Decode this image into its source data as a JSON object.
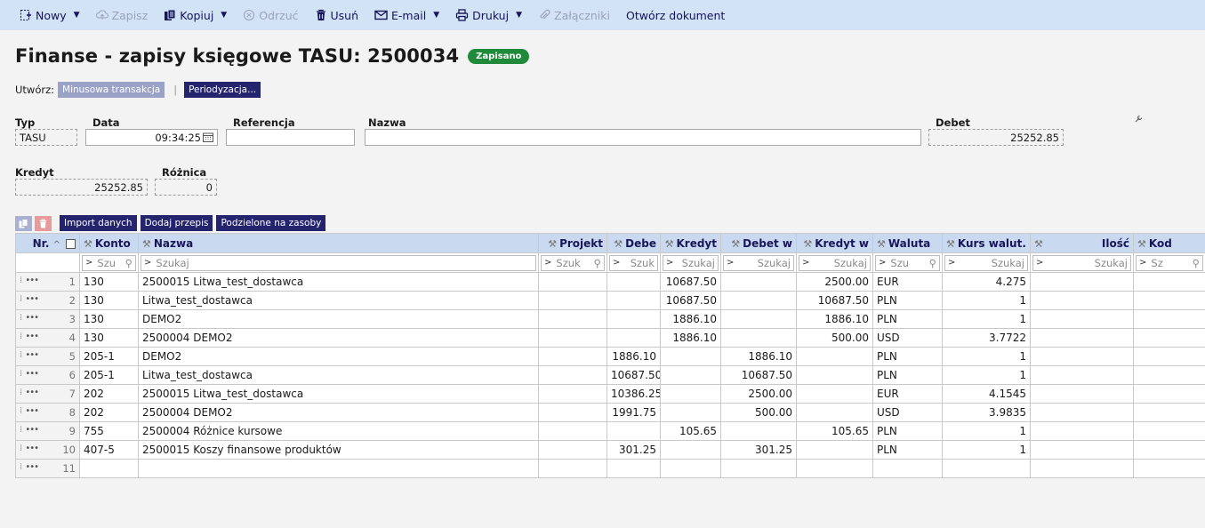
{
  "toolbar": {
    "new": "Nowy",
    "save": "Zapisz",
    "copy": "Kopiuj",
    "discard": "Odrzuć",
    "delete": "Usuń",
    "email": "E-mail",
    "print": "Drukuj",
    "attachments": "Załączniki",
    "open_document": "Otwórz dokument"
  },
  "header": {
    "title": "Finanse - zapisy księgowe TASU: 2500034",
    "status": "Zapisano"
  },
  "create": {
    "label": "Utwórz:",
    "minus_transaction": "Minusowa transakcja",
    "periodization": "Periodyzacja..."
  },
  "fields": {
    "type_label": "Typ",
    "type_value": "TASU",
    "date_label": "Data",
    "date_value": "09:34:25",
    "reference_label": "Referencja",
    "reference_value": "",
    "name_label": "Nazwa",
    "name_value": "",
    "debit_label": "Debet",
    "debit_value": "25252.85",
    "credit_label": "Kredyt",
    "credit_value": "25252.85",
    "difference_label": "Różnica",
    "difference_value": "0"
  },
  "grid_actions": {
    "import": "Import danych",
    "add_rule": "Dodaj przepis",
    "split": "Podzielone na zasoby"
  },
  "columns": {
    "nr": "Nr.",
    "account": "Konto",
    "name": "Nazwa",
    "project": "Projekt",
    "debit": "Debe",
    "credit": "Kredyt",
    "debit_cur": "Debet w",
    "credit_cur": "Kredyt w",
    "currency": "Waluta",
    "rate": "Kurs walut.",
    "quantity": "Ilość",
    "code": "Kod"
  },
  "search": {
    "account": "Szu",
    "name": "Szukaj",
    "project": "Szuk",
    "debit": "Szuk",
    "credit": "Szukaj",
    "debit_cur": "Szukaj",
    "credit_cur": "Szukaj",
    "currency": "Szu",
    "rate": "Szukaj",
    "quantity": "Szukaj",
    "code": "Sz"
  },
  "rows": [
    {
      "nr": "1",
      "account": "130",
      "name": "2500015 Litwa_test_dostawca",
      "project": "",
      "debit": "",
      "credit": "10687.50",
      "debit_cur": "",
      "credit_cur": "2500.00",
      "currency": "EUR",
      "rate": "4.275",
      "quantity": "",
      "code": ""
    },
    {
      "nr": "2",
      "account": "130",
      "name": "Litwa_test_dostawca",
      "project": "",
      "debit": "",
      "credit": "10687.50",
      "debit_cur": "",
      "credit_cur": "10687.50",
      "currency": "PLN",
      "rate": "1",
      "quantity": "",
      "code": ""
    },
    {
      "nr": "3",
      "account": "130",
      "name": "DEMO2",
      "project": "",
      "debit": "",
      "credit": "1886.10",
      "debit_cur": "",
      "credit_cur": "1886.10",
      "currency": "PLN",
      "rate": "1",
      "quantity": "",
      "code": ""
    },
    {
      "nr": "4",
      "account": "130",
      "name": "2500004 DEMO2",
      "project": "",
      "debit": "",
      "credit": "1886.10",
      "debit_cur": "",
      "credit_cur": "500.00",
      "currency": "USD",
      "rate": "3.7722",
      "quantity": "",
      "code": ""
    },
    {
      "nr": "5",
      "account": "205-1",
      "name": "DEMO2",
      "project": "",
      "debit": "1886.10",
      "credit": "",
      "debit_cur": "1886.10",
      "credit_cur": "",
      "currency": "PLN",
      "rate": "1",
      "quantity": "",
      "code": ""
    },
    {
      "nr": "6",
      "account": "205-1",
      "name": "Litwa_test_dostawca",
      "project": "",
      "debit": "10687.50",
      "credit": "",
      "debit_cur": "10687.50",
      "credit_cur": "",
      "currency": "PLN",
      "rate": "1",
      "quantity": "",
      "code": ""
    },
    {
      "nr": "7",
      "account": "202",
      "name": "2500015 Litwa_test_dostawca",
      "project": "",
      "debit": "10386.25",
      "credit": "",
      "debit_cur": "2500.00",
      "credit_cur": "",
      "currency": "EUR",
      "rate": "4.1545",
      "quantity": "",
      "code": ""
    },
    {
      "nr": "8",
      "account": "202",
      "name": "2500004 DEMO2",
      "project": "",
      "debit": "1991.75",
      "credit": "",
      "debit_cur": "500.00",
      "credit_cur": "",
      "currency": "USD",
      "rate": "3.9835",
      "quantity": "",
      "code": ""
    },
    {
      "nr": "9",
      "account": "755",
      "name": "2500004 Różnice kursowe",
      "project": "",
      "debit": "",
      "credit": "105.65",
      "debit_cur": "",
      "credit_cur": "105.65",
      "currency": "PLN",
      "rate": "1",
      "quantity": "",
      "code": ""
    },
    {
      "nr": "10",
      "account": "407-5",
      "name": "2500015 Koszy finansowe produktów",
      "project": "",
      "debit": "301.25",
      "credit": "",
      "debit_cur": "301.25",
      "credit_cur": "",
      "currency": "PLN",
      "rate": "1",
      "quantity": "",
      "code": ""
    },
    {
      "nr": "11",
      "account": "",
      "name": "",
      "project": "",
      "debit": "",
      "credit": "",
      "debit_cur": "",
      "credit_cur": "",
      "currency": "",
      "rate": "",
      "quantity": "",
      "code": ""
    }
  ]
}
